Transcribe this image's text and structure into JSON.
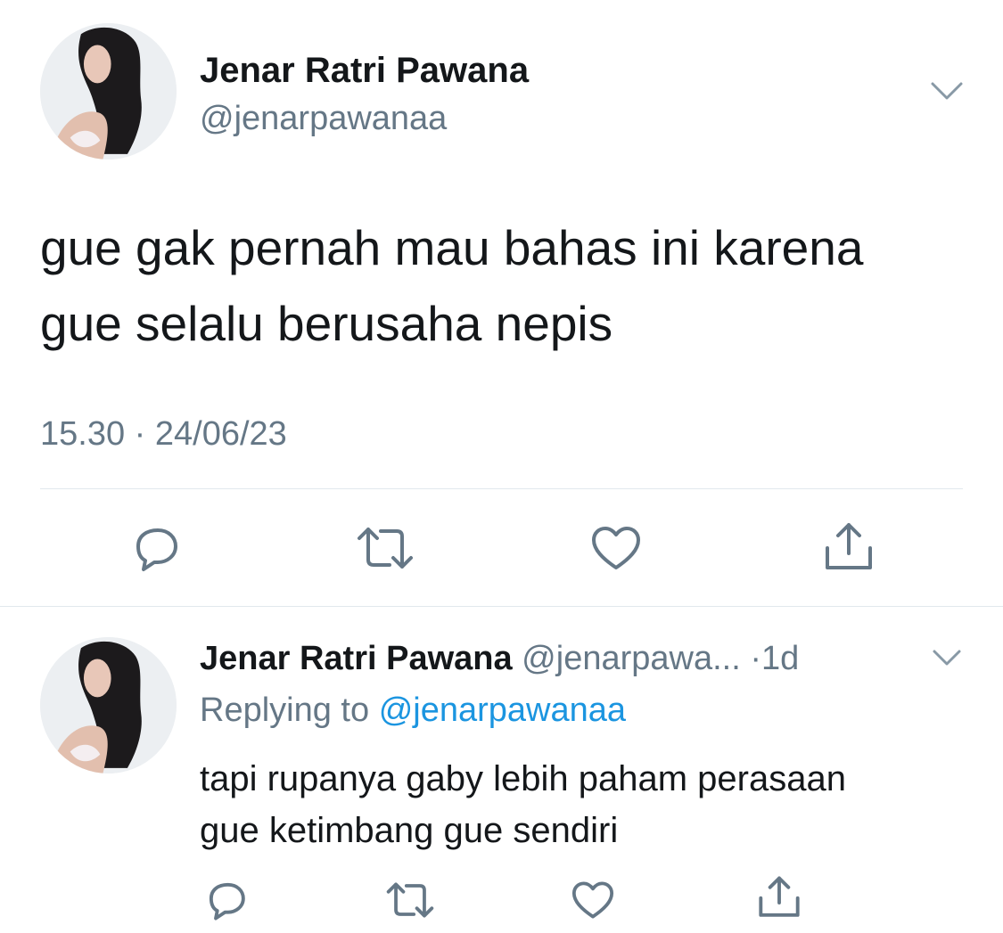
{
  "main_tweet": {
    "author_name": "Jenar Ratri Pawana",
    "handle": "@jenarpawanaa",
    "text_lines": [
      "gue gak pernah mau bahas ini karena",
      "gue selalu berusaha nepis"
    ],
    "time": "15.30",
    "separator": "·",
    "date": "24/06/23",
    "actions": [
      "reply-icon",
      "retweet-icon",
      "like-icon",
      "share-icon"
    ]
  },
  "reply_tweet": {
    "author_name": "Jenar Ratri Pawana",
    "handle": "@jenarpawa...",
    "time_separator": "·",
    "age": "1d",
    "replying_label": "Replying to",
    "replying_to": "@jenarpawanaa",
    "text_lines": [
      "tapi rupanya gaby lebih paham perasaan",
      "gue ketimbang gue sendiri"
    ],
    "actions": [
      "reply-icon",
      "retweet-icon",
      "like-icon",
      "share-icon"
    ]
  },
  "colors": {
    "text_primary": "#14171a",
    "text_secondary": "#657786",
    "link": "#1b95e0",
    "divider": "#e1e8ed",
    "icon": "#657786"
  }
}
